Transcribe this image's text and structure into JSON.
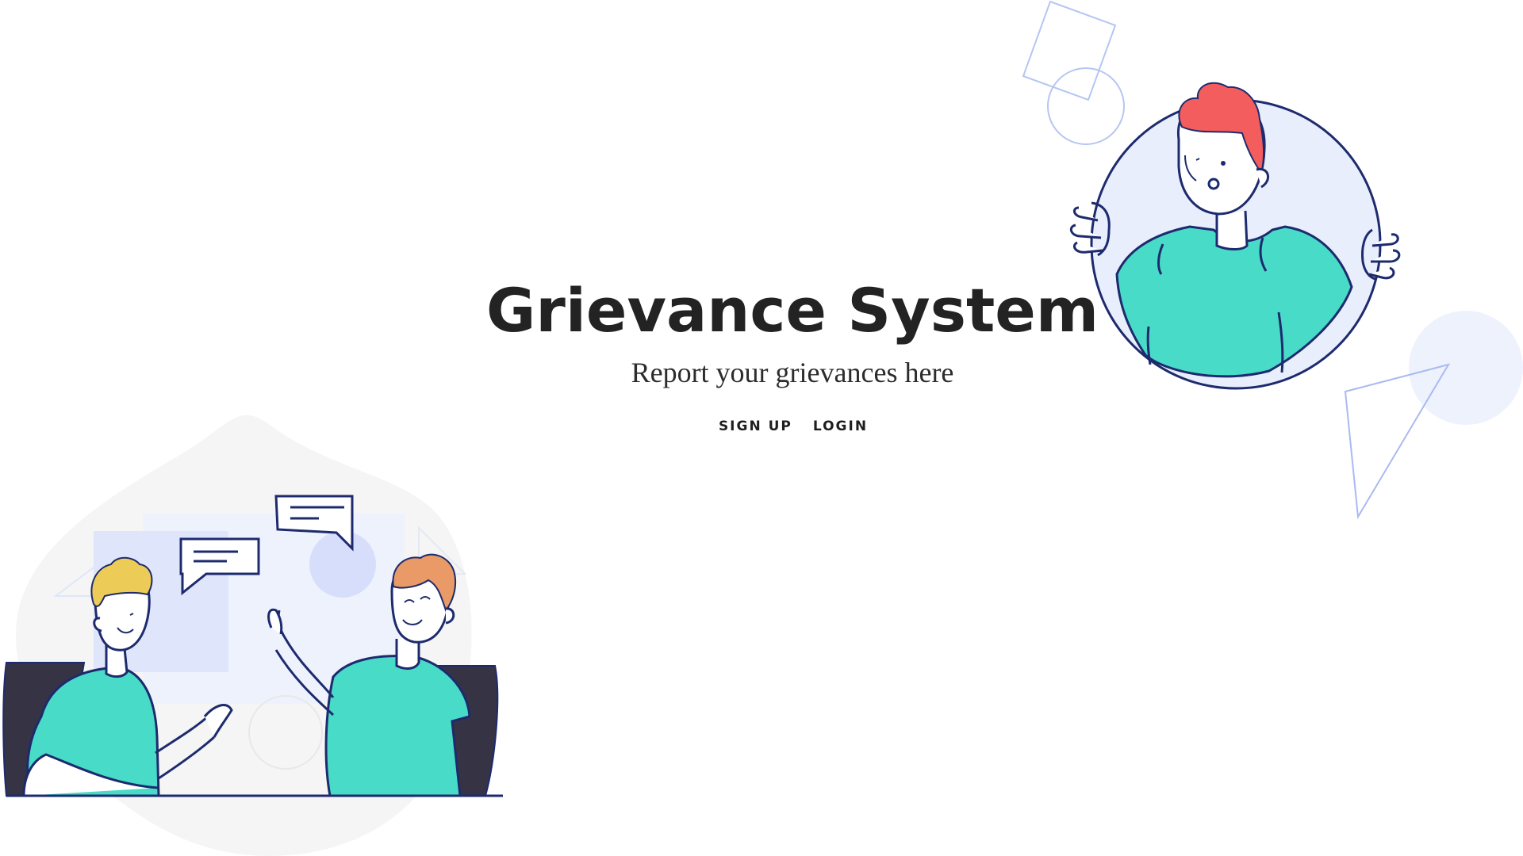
{
  "hero": {
    "title": "Grievance System",
    "subtitle": "Report your grievances here"
  },
  "nav": {
    "signup_label": "SIGN UP",
    "login_label": "LOGIN"
  },
  "colors": {
    "shirt": "#48dbc8",
    "outline": "#1d2b6e",
    "accent_soft": "#e9eefc",
    "hair_red": "#f35d5d",
    "hair_yellow": "#edcb57",
    "hair_orange": "#e99a66",
    "chair": "#363345"
  }
}
